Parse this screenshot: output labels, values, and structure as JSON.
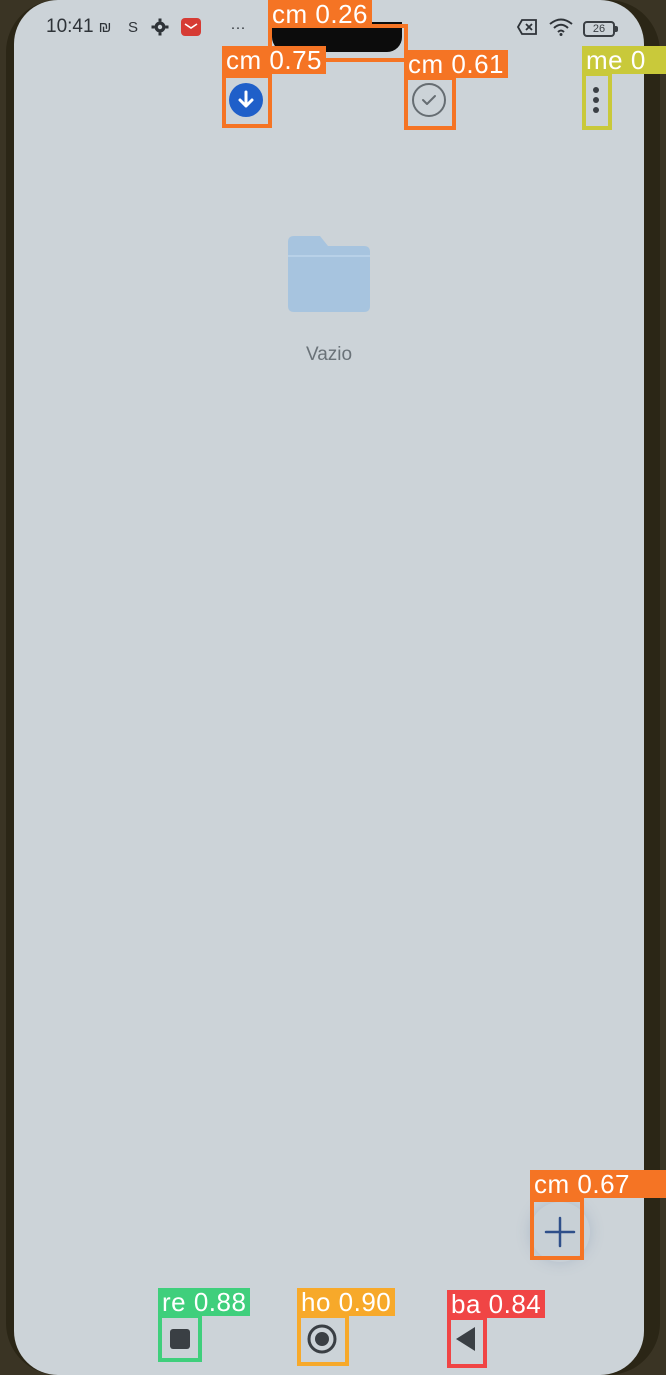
{
  "status_bar": {
    "time": "10:41",
    "nfc_glyph": "₪",
    "s_glyph": "S",
    "more_glyph": "···",
    "battery_level": "26"
  },
  "empty_state": {
    "label": "Vazio"
  },
  "icons": {
    "download": "download-icon",
    "check": "check-circle-icon",
    "menu": "more-vertical-icon",
    "fab": "plus-icon",
    "recents": "square-icon",
    "home": "circle-icon",
    "back": "triangle-back-icon"
  },
  "detections": [
    {
      "label": "cm 0.26",
      "color": "#f57424"
    },
    {
      "label": "cm 0.75",
      "color": "#f57424"
    },
    {
      "label": "cm 0.61",
      "color": "#f57424"
    },
    {
      "label": "me 0",
      "color": "#c9c93a"
    },
    {
      "label": "cm 0.67",
      "color": "#f57424"
    },
    {
      "label": "re 0.88",
      "color": "#3fcf7c"
    },
    {
      "label": "ho 0.90",
      "color": "#f7a92a"
    },
    {
      "label": "ba 0.84",
      "color": "#f04545"
    }
  ],
  "colors": {
    "screen_bg": "#ccd3d8",
    "accent_blue": "#1f5fc9",
    "folder_blue": "#a7c4df"
  }
}
